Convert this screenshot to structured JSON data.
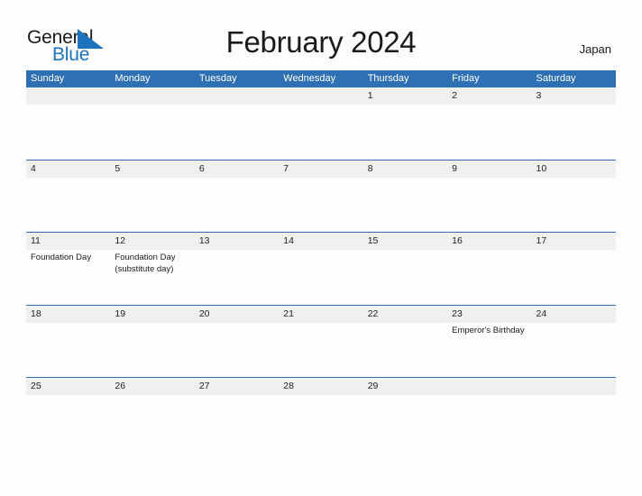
{
  "brand": {
    "name_part1": "General",
    "name_part2": "Blue",
    "flag_icon": "blue-triangle-flag-icon",
    "accent_color": "#1B73BE"
  },
  "header": {
    "title": "February 2024",
    "country": "Japan",
    "header_bg_color": "#2E70B3",
    "band_bg_color": "#F0F0F0"
  },
  "calendar": {
    "month": "February",
    "year": "2024",
    "weekdays": [
      "Sunday",
      "Monday",
      "Tuesday",
      "Wednesday",
      "Thursday",
      "Friday",
      "Saturday"
    ],
    "weeks": [
      {
        "days": [
          {
            "num": "",
            "event": ""
          },
          {
            "num": "",
            "event": ""
          },
          {
            "num": "",
            "event": ""
          },
          {
            "num": "",
            "event": ""
          },
          {
            "num": "1",
            "event": ""
          },
          {
            "num": "2",
            "event": ""
          },
          {
            "num": "3",
            "event": ""
          }
        ]
      },
      {
        "days": [
          {
            "num": "4",
            "event": ""
          },
          {
            "num": "5",
            "event": ""
          },
          {
            "num": "6",
            "event": ""
          },
          {
            "num": "7",
            "event": ""
          },
          {
            "num": "8",
            "event": ""
          },
          {
            "num": "9",
            "event": ""
          },
          {
            "num": "10",
            "event": ""
          }
        ]
      },
      {
        "days": [
          {
            "num": "11",
            "event": "Foundation Day"
          },
          {
            "num": "12",
            "event": "Foundation Day (substitute day)"
          },
          {
            "num": "13",
            "event": ""
          },
          {
            "num": "14",
            "event": ""
          },
          {
            "num": "15",
            "event": ""
          },
          {
            "num": "16",
            "event": ""
          },
          {
            "num": "17",
            "event": ""
          }
        ]
      },
      {
        "days": [
          {
            "num": "18",
            "event": ""
          },
          {
            "num": "19",
            "event": ""
          },
          {
            "num": "20",
            "event": ""
          },
          {
            "num": "21",
            "event": ""
          },
          {
            "num": "22",
            "event": ""
          },
          {
            "num": "23",
            "event": "Emperor's Birthday"
          },
          {
            "num": "24",
            "event": ""
          }
        ]
      },
      {
        "days": [
          {
            "num": "25",
            "event": ""
          },
          {
            "num": "26",
            "event": ""
          },
          {
            "num": "27",
            "event": ""
          },
          {
            "num": "28",
            "event": ""
          },
          {
            "num": "29",
            "event": ""
          },
          {
            "num": "",
            "event": ""
          },
          {
            "num": "",
            "event": ""
          }
        ]
      }
    ]
  }
}
